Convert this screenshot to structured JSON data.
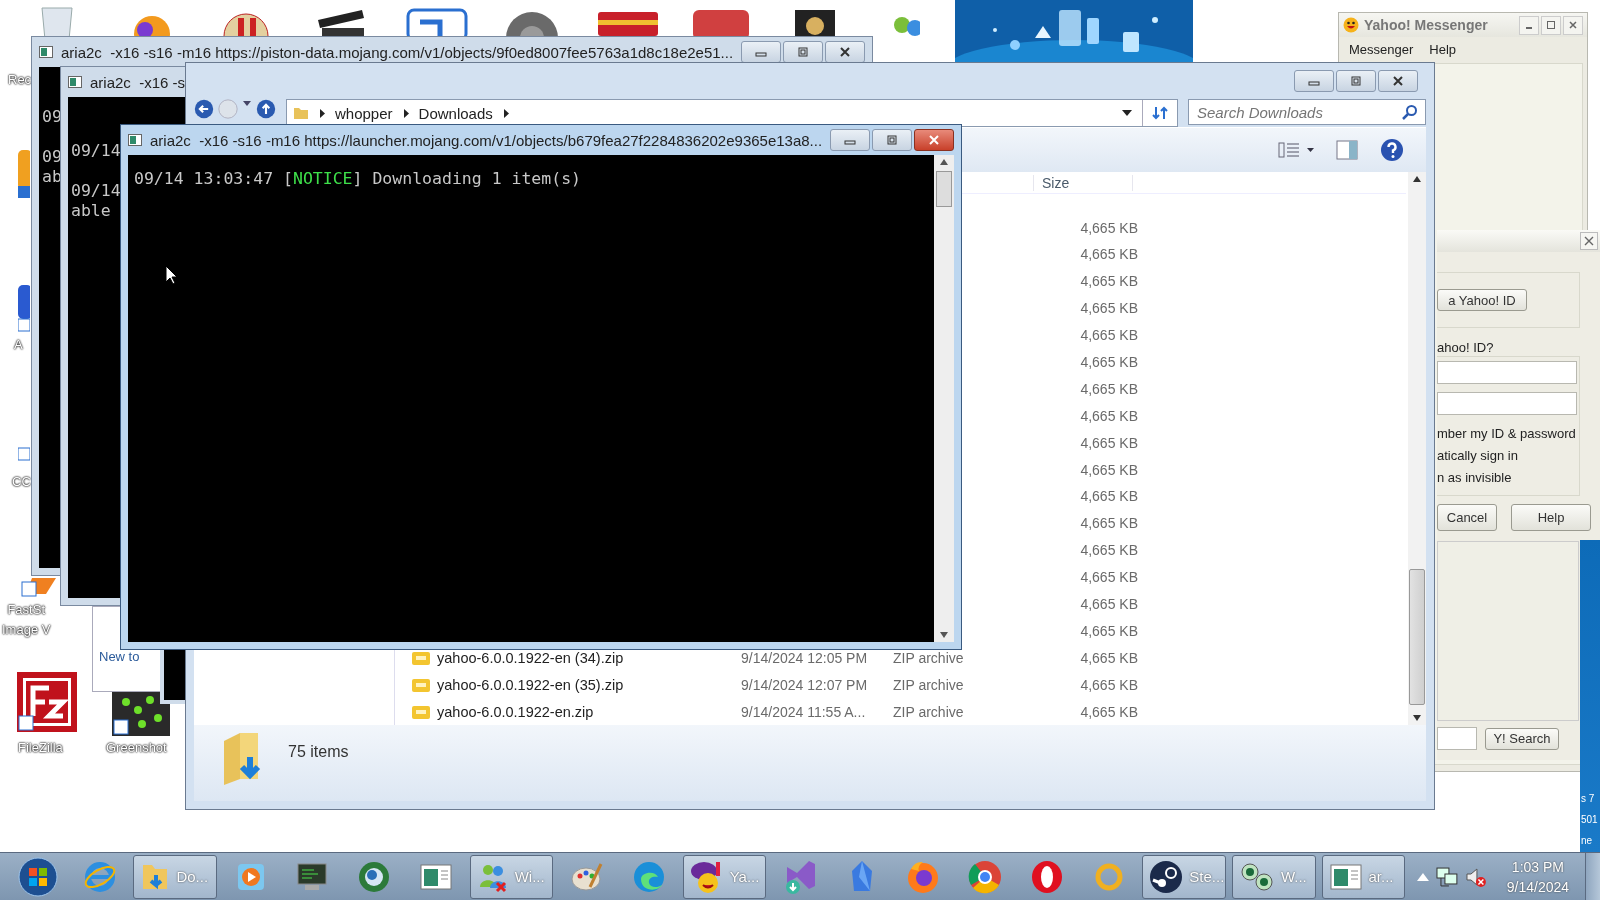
{
  "desktop_icons": [
    {
      "lines": [
        "Rec"
      ]
    },
    {
      "lines": [
        "A"
      ]
    },
    {
      "lines": [
        "CC"
      ]
    },
    {
      "lines": [
        "FastSt",
        "Image V"
      ]
    },
    {
      "lines": [
        "FileZilla"
      ]
    },
    {
      "lines": [
        "Greenshot"
      ]
    }
  ],
  "back_windows": [
    {
      "title": "aria2c  -x16 -s16 -m16 https://piston-data.mojang.com/v1/objects/9f0ed8007fee5763a1d8c18e2e51...",
      "lines": [
        "09",
        "09",
        "ab"
      ]
    },
    {
      "title": "aria2c  -x16 -s",
      "lines": [
        "09/14",
        "09/14",
        "able"
      ]
    }
  ],
  "new_to_window": {
    "text": "New to"
  },
  "messenger": {
    "title": "Yahoo! Messenger",
    "menu": [
      "Messenger",
      "Help"
    ],
    "create_button": "a Yahoo! ID",
    "section_label": "ahoo! ID?",
    "options": [
      "mber my ID & password",
      "atically sign in",
      "n as invisible"
    ],
    "buttons": [
      "Cancel",
      "Help"
    ],
    "search_button": "Y! Search"
  },
  "explorer": {
    "breadcrumbs": [
      "whopper",
      "Downloads"
    ],
    "search": {
      "placeholder": "Search Downloads"
    },
    "columns": [
      "Size"
    ],
    "rows": [
      {
        "size": "4,665 KB"
      },
      {
        "size": "4,665 KB"
      },
      {
        "size": "4,665 KB"
      },
      {
        "size": "4,665 KB"
      },
      {
        "size": "4,665 KB"
      },
      {
        "size": "4,665 KB"
      },
      {
        "size": "4,665 KB"
      },
      {
        "size": "4,665 KB"
      },
      {
        "size": "4,665 KB"
      },
      {
        "size": "4,665 KB"
      },
      {
        "size": "4,665 KB"
      },
      {
        "size": "4,665 KB"
      },
      {
        "size": "4,665 KB"
      },
      {
        "size": "4,665 KB"
      },
      {
        "size": "4,665 KB"
      },
      {
        "size": "4,665 KB"
      },
      {
        "name": "yahoo-6.0.0.1922-en (34).zip",
        "date": "9/14/2024 12:05 PM",
        "type": "ZIP archive",
        "size": "4,665 KB"
      },
      {
        "name": "yahoo-6.0.0.1922-en (35).zip",
        "date": "9/14/2024 12:07 PM",
        "type": "ZIP archive",
        "size": "4,665 KB"
      },
      {
        "name": "yahoo-6.0.0.1922-en.zip",
        "date": "9/14/2024 11:55 A...",
        "type": "ZIP archive",
        "size": "4,665 KB"
      }
    ],
    "status": "75 items"
  },
  "console": {
    "title": "aria2c  -x16 -s16 -m16 https://launcher.mojang.com/v1/objects/b679fea27f2284836202e9365e13a8...",
    "lines": [
      {
        "time": "09/14 13:03:47",
        "open": "[",
        "level": "NOTICE",
        "close": "]",
        "message": "Downloading 1 item(s)"
      }
    ]
  },
  "edge_texts": [
    "s 7",
    "501",
    "ne"
  ],
  "taskbar": {
    "items": [
      {
        "kind": "start"
      },
      {
        "kind": "ie"
      },
      {
        "kind": "folder",
        "label": "Do..."
      },
      {
        "kind": "media"
      },
      {
        "kind": "monitor"
      },
      {
        "kind": "globe"
      },
      {
        "kind": "window"
      },
      {
        "kind": "people",
        "label": "Wi..."
      },
      {
        "kind": "paint"
      },
      {
        "kind": "edge"
      },
      {
        "kind": "yahoo",
        "label": "Ya..."
      },
      {
        "kind": "vs"
      },
      {
        "kind": "crystal"
      },
      {
        "kind": "firefox"
      },
      {
        "kind": "chrome"
      },
      {
        "kind": "opera"
      },
      {
        "kind": "ring"
      },
      {
        "kind": "steam",
        "label": "Ste..."
      },
      {
        "kind": "eyes",
        "label": "W..."
      },
      {
        "kind": "console",
        "label": "ar..."
      }
    ],
    "time": "1:03 PM",
    "date": "9/14/2024"
  }
}
